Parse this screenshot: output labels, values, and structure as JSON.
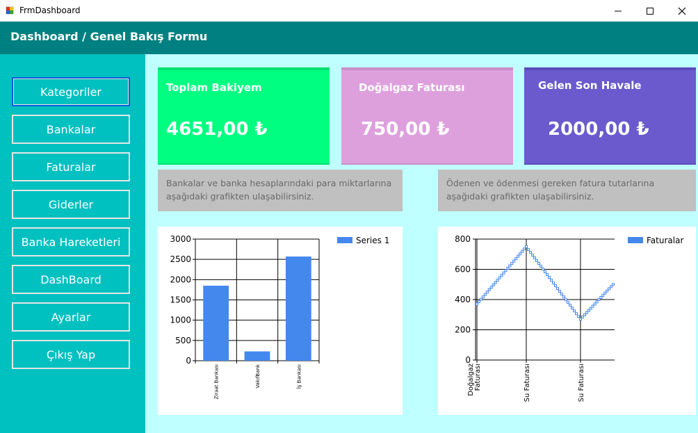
{
  "window": {
    "title": "FrmDashboard"
  },
  "header": {
    "title": "Dashboard / Genel Bakış Formu"
  },
  "sidebar": {
    "items": [
      {
        "label": "Kategoriler",
        "active": true
      },
      {
        "label": "Bankalar"
      },
      {
        "label": "Faturalar"
      },
      {
        "label": "Giderler"
      },
      {
        "label": "Banka Hareketleri"
      },
      {
        "label": "DashBoard"
      },
      {
        "label": "Ayarlar"
      },
      {
        "label": "Çıkış Yap"
      }
    ]
  },
  "cards": [
    {
      "title": "Toplam Bakiyem",
      "value": "4651,00 ₺",
      "color": "#00ff80",
      "border": "#00e070"
    },
    {
      "title": "Doğalgaz Faturası",
      "value": "750,00 ₺",
      "color": "#dda0dd",
      "border": "#c98fc9"
    },
    {
      "title": "Gelen Son Havale",
      "value": "2000,00 ₺",
      "color": "#6a5acd",
      "border": "#5a4bbd"
    }
  ],
  "info": {
    "left": "Bankalar ve banka hesaplarındaki para miktarlarına aşağıdaki grafikten ulaşabilirsiniz.",
    "right": "Ödenen ve ödenmesi gereken fatura tutarlarına aşağıdaki grafikten ulaşabilirsiniz."
  },
  "colors": {
    "series": "#4488ee"
  },
  "chart_data": [
    {
      "type": "bar",
      "categories": [
        "Ziraat Bankası",
        "VakıfBank",
        "İş Bankası"
      ],
      "series": [
        {
          "name": "Series 1",
          "values": [
            1850,
            230,
            2570
          ]
        }
      ],
      "ylim": [
        0,
        3000
      ],
      "yticks": [
        0,
        500,
        1000,
        1500,
        2000,
        2500,
        3000
      ],
      "grid": true,
      "legend": "top-right"
    },
    {
      "type": "line",
      "categories": [
        "Doğalgaz Faturası",
        "Su Faturası",
        "Su Faturası"
      ],
      "series": [
        {
          "name": "Faturalar",
          "values": [
            370,
            750,
            270,
            500
          ]
        }
      ],
      "ylim": [
        0,
        800
      ],
      "yticks": [
        0,
        200,
        400,
        600,
        800
      ],
      "grid": true,
      "legend": "top-right"
    }
  ]
}
